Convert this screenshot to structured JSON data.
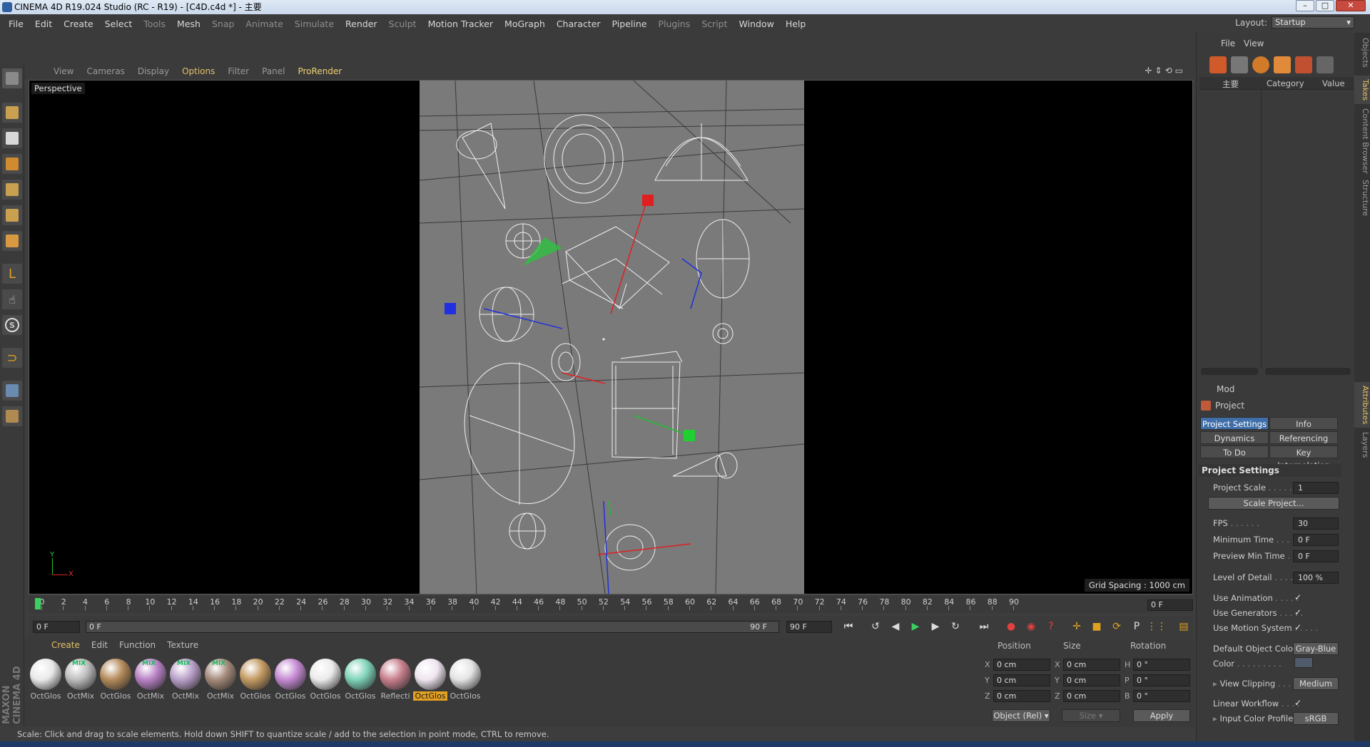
{
  "window": {
    "title": "CINEMA 4D R19.024 Studio (RC - R19) - [C4D.c4d *] - 主要"
  },
  "menu": [
    "File",
    "Edit",
    "Create",
    "Select",
    "Tools",
    "Mesh",
    "Snap",
    "Animate",
    "Simulate",
    "Render",
    "Sculpt",
    "Motion Tracker",
    "MoGraph",
    "Character",
    "Pipeline",
    "Plugins",
    "Script",
    "Window",
    "Help"
  ],
  "menu_dim": [
    "Tools",
    "Snap",
    "Animate",
    "Simulate",
    "Sculpt",
    "Plugins",
    "Script"
  ],
  "layout": {
    "label": "Layout:",
    "value": "Startup"
  },
  "viewport": {
    "menu": [
      "View",
      "Cameras",
      "Display",
      "Options",
      "Filter",
      "Panel",
      "ProRender"
    ],
    "camera_label": "Perspective",
    "grid_spacing": "Grid Spacing : 1000 cm",
    "axis_y": "Y",
    "axis_x": "X"
  },
  "timeline": {
    "ticks": [
      "0",
      "2",
      "4",
      "6",
      "8",
      "10",
      "12",
      "14",
      "16",
      "18",
      "20",
      "22",
      "24",
      "26",
      "28",
      "30",
      "32",
      "34",
      "36",
      "38",
      "40",
      "42",
      "44",
      "46",
      "48",
      "50",
      "52",
      "54",
      "56",
      "58",
      "60",
      "62",
      "64",
      "66",
      "68",
      "70",
      "72",
      "74",
      "76",
      "78",
      "80",
      "82",
      "84",
      "86",
      "88",
      "90"
    ],
    "current_frame": "0 F",
    "start": "0 F",
    "range_start": "0 F",
    "range_end": "90 F",
    "end": "90 F"
  },
  "materials": {
    "tabs": [
      "Create",
      "Edit",
      "Function",
      "Texture"
    ],
    "items": [
      {
        "label": "OctGlos",
        "color": "#e9e9e9",
        "tag": ""
      },
      {
        "label": "OctMix",
        "color": "#bdbdbd",
        "tag": "MIX"
      },
      {
        "label": "OctGlos",
        "color": "#b48a5a",
        "tag": ""
      },
      {
        "label": "OctMix",
        "color": "#b882c4",
        "tag": "MIX"
      },
      {
        "label": "OctMix",
        "color": "#b9a0c9",
        "tag": "MIX"
      },
      {
        "label": "OctMix",
        "color": "#a48a7a",
        "tag": "MIX"
      },
      {
        "label": "OctGlos",
        "color": "#c39a62",
        "tag": ""
      },
      {
        "label": "OctGlos",
        "color": "#c58ad2",
        "tag": ""
      },
      {
        "label": "OctGlos",
        "color": "#ebebeb",
        "tag": ""
      },
      {
        "label": "OctGlos",
        "color": "#7fd3b9",
        "tag": ""
      },
      {
        "label": "Reflecti",
        "color": "#c77f8c",
        "tag": ""
      },
      {
        "label": "OctGlos",
        "color": "#efe6ef",
        "tag": "",
        "selected": true
      },
      {
        "label": "OctGlos",
        "color": "#e4e4e4",
        "tag": ""
      }
    ]
  },
  "coords": {
    "headers": [
      "Position",
      "Size",
      "Rotation"
    ],
    "rows": [
      {
        "a": "X",
        "pos": "0 cm",
        "b": "X",
        "size": "0 cm",
        "c": "H",
        "rot": "0 °"
      },
      {
        "a": "Y",
        "pos": "0 cm",
        "b": "Y",
        "size": "0 cm",
        "c": "P",
        "rot": "0 °"
      },
      {
        "a": "Z",
        "pos": "0 cm",
        "b": "Z",
        "size": "0 cm",
        "c": "B",
        "rot": "0 °"
      }
    ],
    "mode": "Object (Rel)",
    "size_mode": "Size",
    "apply": "Apply"
  },
  "status": "Scale: Click and drag to scale elements. Hold down SHIFT to quantize scale / add to the selection in point mode, CTRL to remove.",
  "objects_panel": {
    "menu": [
      "File",
      "View"
    ],
    "root": "主要",
    "columns": [
      "Category",
      "Value"
    ]
  },
  "attributes": {
    "menu": "Mod",
    "title": "Project",
    "tabs": [
      "Project Settings",
      "Info",
      "Dynamics",
      "Referencing",
      "To Do",
      "Key Interpolation"
    ],
    "section": "Project Settings",
    "rows": [
      {
        "label": "Project Scale",
        "value": "1"
      },
      {
        "label": "FPS",
        "value": "30"
      },
      {
        "label": "Minimum Time",
        "value": "0 F"
      },
      {
        "label": "Preview Min Time",
        "value": "0 F"
      },
      {
        "label": "Level of Detail",
        "value": "100 %"
      }
    ],
    "scale_btn": "Scale Project...",
    "checks": [
      "Use Animation",
      "Use Generators",
      "Use Motion System"
    ],
    "default_color_label": "Default Object Color",
    "default_color_value": "Gray-Blue",
    "color_label": "Color",
    "view_clipping_label": "View Clipping",
    "view_clipping_value": "Medium",
    "linear_workflow": "Linear Workflow",
    "input_profile_label": "Input Color Profile",
    "input_profile_value": "sRGB"
  },
  "side_tabs": [
    "Objects",
    "Takes",
    "Content Browser",
    "Structure",
    "Attributes",
    "Layers"
  ]
}
